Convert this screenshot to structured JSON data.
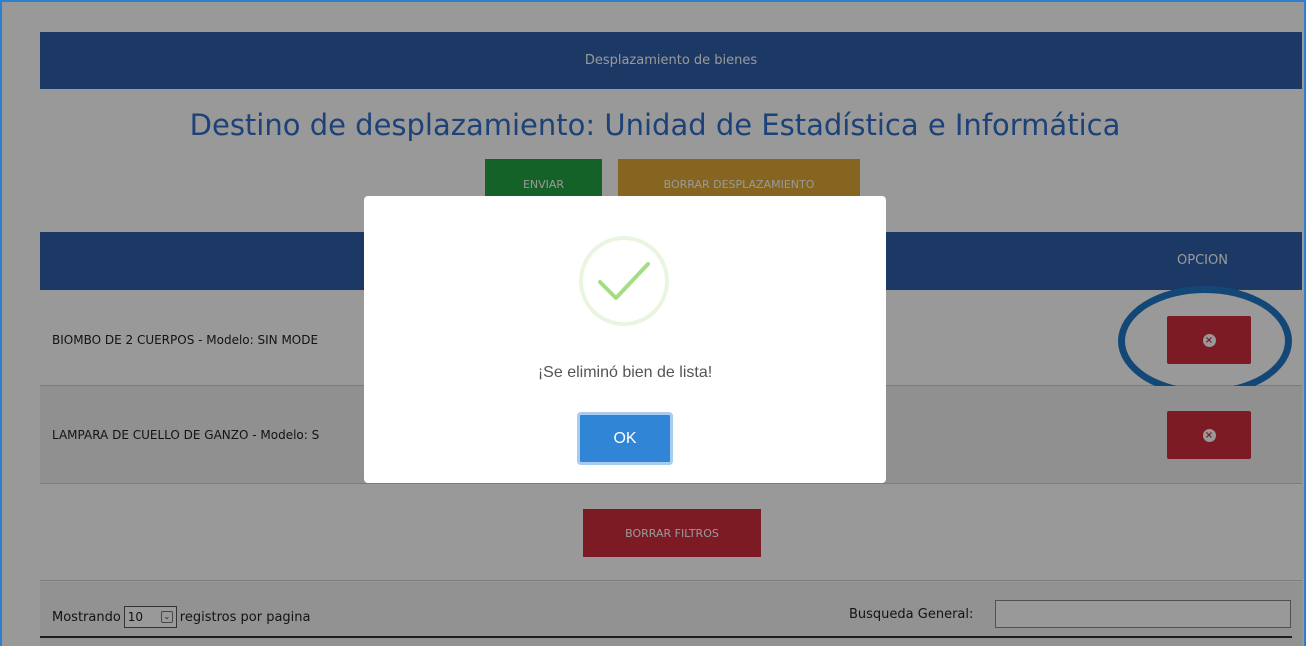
{
  "panel": {
    "header": "Desplazamiento de bienes"
  },
  "page": {
    "title": "Destino de desplazamiento: Unidad de Estadística e Informática"
  },
  "actions": {
    "send_label": "ENVIAR",
    "clear_label": "BORRAR DESPLAZAMIENTO"
  },
  "table": {
    "option_header": "OPCION",
    "rows": [
      {
        "text": "BIOMBO DE 2 CUERPOS - Modelo: SIN MODE"
      },
      {
        "text": "LAMPARA DE CUELLO DE GANZO - Modelo: S"
      }
    ]
  },
  "filters": {
    "clear_label": "BORRAR FILTROS"
  },
  "pager": {
    "show_prefix": "Mostrando",
    "page_size": "10",
    "show_suffix": "registros por pagina",
    "search_label": "Busqueda General:"
  },
  "dialog": {
    "message": "¡Se eliminó bien de lista!",
    "ok_label": "OK"
  },
  "colors": {
    "primary": "#2f5ea8",
    "success": "#23a345",
    "warning": "#e0a936",
    "danger": "#d12d3e",
    "dialog_button": "#3085d6"
  }
}
